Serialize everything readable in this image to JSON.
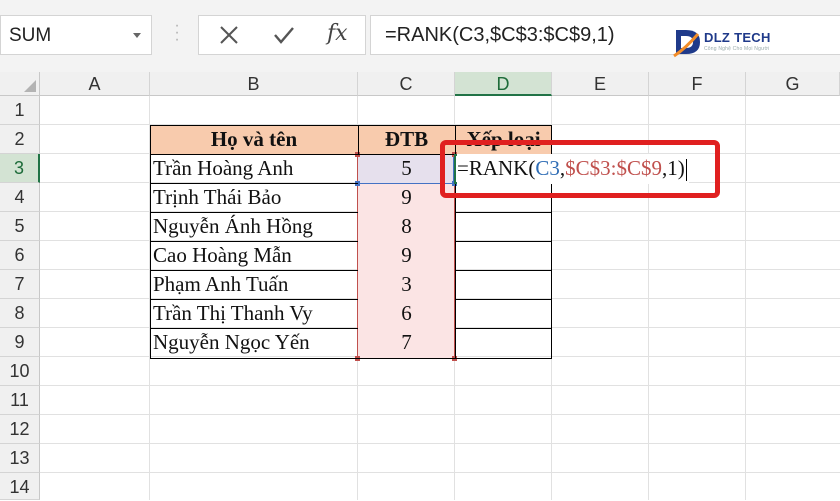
{
  "formula_bar": {
    "name_box": "SUM",
    "cancel_icon": "x-icon",
    "enter_icon": "check-icon",
    "function_icon": "fx",
    "formula": "=RANK(C3,$C$3:$C$9,1)"
  },
  "logo": {
    "text": "DLZ TECH",
    "tagline": "Công Nghệ Cho Mọi Người"
  },
  "columns": [
    "A",
    "B",
    "C",
    "D",
    "E",
    "F",
    "G"
  ],
  "rows": [
    "1",
    "2",
    "3",
    "4",
    "5",
    "6",
    "7",
    "8",
    "9",
    "10",
    "11",
    "12",
    "13",
    "14"
  ],
  "table": {
    "headers": {
      "name": "Họ và tên",
      "score": "ĐTB",
      "rank": "Xếp loại"
    },
    "rows": [
      {
        "name": "Trần Hoàng Anh",
        "score": "5"
      },
      {
        "name": "Trịnh Thái Bảo",
        "score": "9"
      },
      {
        "name": "Nguyễn Ánh Hồng",
        "score": "8"
      },
      {
        "name": "Cao Hoàng Mẫn",
        "score": "9"
      },
      {
        "name": "Phạm Anh Tuấn",
        "score": "3"
      },
      {
        "name": "Trần Thị Thanh Vy",
        "score": "6"
      },
      {
        "name": "Nguyễn Ngọc Yến",
        "score": "7"
      }
    ]
  },
  "edit_cell": {
    "prefix": "=RANK(",
    "ref1": "C3",
    "sep1": ",",
    "ref2": "$C$3:$C$9",
    "suffix": ",1)"
  },
  "colors": {
    "header_fill": "#f8cbad",
    "score_fill": "#fbe4e4",
    "callout": "#e02020",
    "excel_green": "#217346"
  }
}
